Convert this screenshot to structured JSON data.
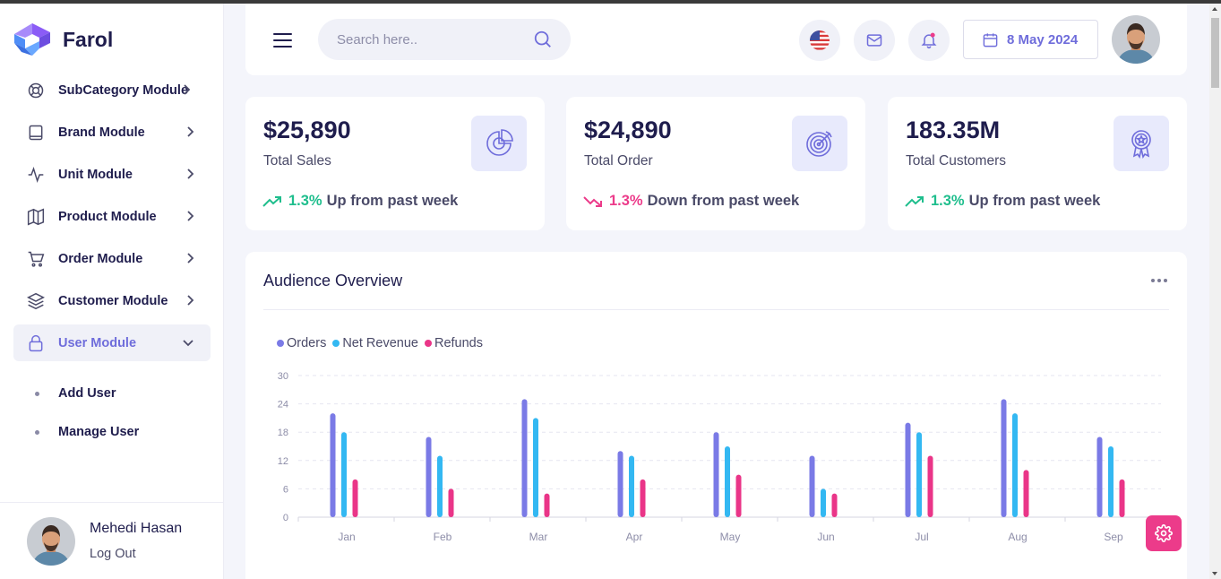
{
  "brand": {
    "name": "Farol"
  },
  "sidebar": {
    "items": [
      {
        "label": "SubCategory Module",
        "icon": "lifebuoy-icon"
      },
      {
        "label": "Brand Module",
        "icon": "book-icon"
      },
      {
        "label": "Unit Module",
        "icon": "activity-icon"
      },
      {
        "label": "Product Module",
        "icon": "map-icon"
      },
      {
        "label": "Order Module",
        "icon": "cart-icon"
      },
      {
        "label": "Customer Module",
        "icon": "layers-icon"
      },
      {
        "label": "User Module",
        "icon": "lock-icon",
        "active": true
      }
    ],
    "sub_items": [
      {
        "label": "Add User"
      },
      {
        "label": "Manage User"
      }
    ],
    "user": {
      "name": "Mehedi Hasan",
      "logout": "Log Out"
    }
  },
  "header": {
    "search_placeholder": "Search here..",
    "date": "8 May 2024"
  },
  "stats": [
    {
      "value": "$25,890",
      "label": "Total Sales",
      "pct": "1.3%",
      "trend_text": "Up from past week",
      "direction": "up",
      "icon": "pie-chart-icon"
    },
    {
      "value": "$24,890",
      "label": "Total Order",
      "pct": "1.3%",
      "trend_text": "Down from past week",
      "direction": "down",
      "icon": "target-icon"
    },
    {
      "value": "183.35M",
      "label": "Total Customers",
      "pct": "1.3%",
      "trend_text": "Up from past week",
      "direction": "up",
      "icon": "award-icon"
    }
  ],
  "colors": {
    "accent": "#6f6ddb",
    "up": "#1fbe8d",
    "down": "#ec3b8a",
    "orders": "#7a7ae6",
    "net_revenue": "#33b8f2",
    "refunds": "#ea3588"
  },
  "panel": {
    "title": "Audience Overview"
  },
  "chart_data": {
    "type": "bar",
    "categories": [
      "Jan",
      "Feb",
      "Mar",
      "Apr",
      "May",
      "Jun",
      "Jul",
      "Aug",
      "Sep"
    ],
    "series": [
      {
        "name": "Orders",
        "values": [
          22,
          17,
          25,
          14,
          18,
          13,
          20,
          25,
          17
        ]
      },
      {
        "name": "Net Revenue",
        "values": [
          18,
          13,
          21,
          13,
          15,
          6,
          18,
          22,
          15
        ]
      },
      {
        "name": "Refunds",
        "values": [
          8,
          6,
          5,
          8,
          9,
          5,
          13,
          10,
          8
        ]
      }
    ],
    "yticks": [
      "0",
      "6",
      "12",
      "18",
      "24",
      "30"
    ],
    "ylim": [
      0,
      30
    ],
    "grid": true,
    "legend": "top-left"
  }
}
